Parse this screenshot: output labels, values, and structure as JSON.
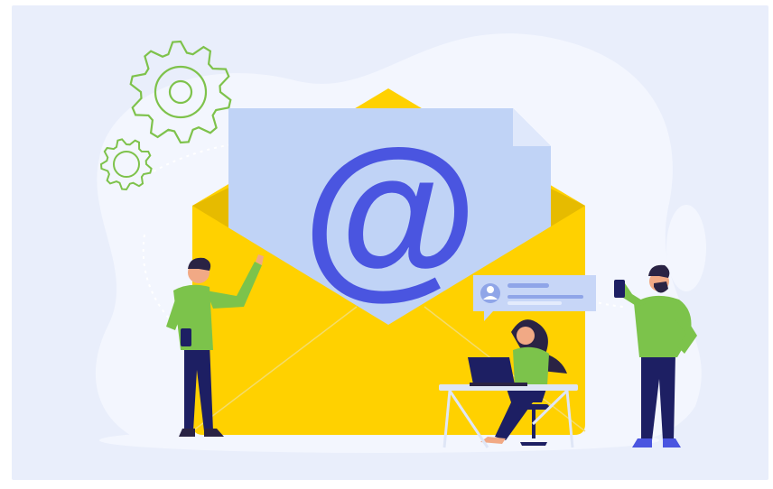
{
  "illustration": {
    "center_symbol": "@",
    "icons": [
      "gear-icon",
      "gear-icon",
      "envelope-icon",
      "at-sign-icon",
      "chat-bubble-icon",
      "user-avatar-icon",
      "laptop-icon",
      "smartphone-icon"
    ],
    "people": [
      "man-waving",
      "woman-at-laptop",
      "man-with-phone"
    ]
  },
  "colors": {
    "background": "#e9eefb",
    "blob": "#f3f6fe",
    "envelope": "#ffd100",
    "envelope_shade": "#e6bb00",
    "letter": "#c0d3f6",
    "letter_fold": "#dfe8fb",
    "at_sign": "#4a55e0",
    "gears": "#7ec24b",
    "shirt": "#7cc34b",
    "pants": "#1d1f63",
    "hair": "#2a2344",
    "skin": "#f1a985",
    "bubble": "#c7d6f7",
    "bubble_text": "#8fa5e8",
    "desk": "#dfe6f6"
  }
}
